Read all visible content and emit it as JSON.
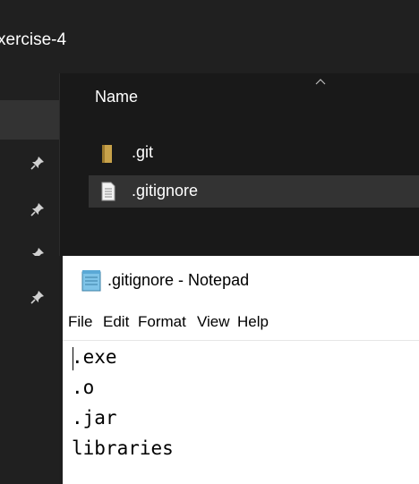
{
  "explorer": {
    "title": "xercise-4",
    "column_header": "Name",
    "files": [
      {
        "name": ".git",
        "icon": "folder-icon",
        "selected": false
      },
      {
        "name": ".gitignore",
        "icon": "text-file-icon",
        "selected": true
      }
    ],
    "quick_access_pins": 4
  },
  "notepad": {
    "title": ".gitignore - Notepad",
    "menu": [
      "File",
      "Edit",
      "Format",
      "View",
      "Help"
    ],
    "content_lines": [
      ".exe",
      ".o",
      ".jar",
      "libraries"
    ]
  },
  "colors": {
    "explorer_bg": "#191919",
    "explorer_selected": "#333333",
    "folder": "#c8a24a",
    "notepad_bg": "#ffffff"
  }
}
